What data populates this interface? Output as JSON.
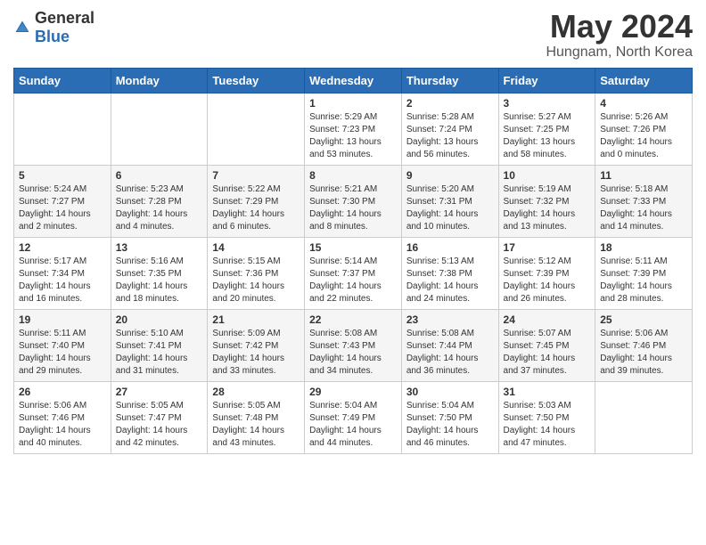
{
  "logo": {
    "general": "General",
    "blue": "Blue"
  },
  "header": {
    "title": "May 2024",
    "subtitle": "Hungnam, North Korea"
  },
  "weekdays": [
    "Sunday",
    "Monday",
    "Tuesday",
    "Wednesday",
    "Thursday",
    "Friday",
    "Saturday"
  ],
  "weeks": [
    [
      {
        "day": "",
        "info": ""
      },
      {
        "day": "",
        "info": ""
      },
      {
        "day": "",
        "info": ""
      },
      {
        "day": "1",
        "info": "Sunrise: 5:29 AM\nSunset: 7:23 PM\nDaylight: 13 hours and 53 minutes."
      },
      {
        "day": "2",
        "info": "Sunrise: 5:28 AM\nSunset: 7:24 PM\nDaylight: 13 hours and 56 minutes."
      },
      {
        "day": "3",
        "info": "Sunrise: 5:27 AM\nSunset: 7:25 PM\nDaylight: 13 hours and 58 minutes."
      },
      {
        "day": "4",
        "info": "Sunrise: 5:26 AM\nSunset: 7:26 PM\nDaylight: 14 hours and 0 minutes."
      }
    ],
    [
      {
        "day": "5",
        "info": "Sunrise: 5:24 AM\nSunset: 7:27 PM\nDaylight: 14 hours and 2 minutes."
      },
      {
        "day": "6",
        "info": "Sunrise: 5:23 AM\nSunset: 7:28 PM\nDaylight: 14 hours and 4 minutes."
      },
      {
        "day": "7",
        "info": "Sunrise: 5:22 AM\nSunset: 7:29 PM\nDaylight: 14 hours and 6 minutes."
      },
      {
        "day": "8",
        "info": "Sunrise: 5:21 AM\nSunset: 7:30 PM\nDaylight: 14 hours and 8 minutes."
      },
      {
        "day": "9",
        "info": "Sunrise: 5:20 AM\nSunset: 7:31 PM\nDaylight: 14 hours and 10 minutes."
      },
      {
        "day": "10",
        "info": "Sunrise: 5:19 AM\nSunset: 7:32 PM\nDaylight: 14 hours and 13 minutes."
      },
      {
        "day": "11",
        "info": "Sunrise: 5:18 AM\nSunset: 7:33 PM\nDaylight: 14 hours and 14 minutes."
      }
    ],
    [
      {
        "day": "12",
        "info": "Sunrise: 5:17 AM\nSunset: 7:34 PM\nDaylight: 14 hours and 16 minutes."
      },
      {
        "day": "13",
        "info": "Sunrise: 5:16 AM\nSunset: 7:35 PM\nDaylight: 14 hours and 18 minutes."
      },
      {
        "day": "14",
        "info": "Sunrise: 5:15 AM\nSunset: 7:36 PM\nDaylight: 14 hours and 20 minutes."
      },
      {
        "day": "15",
        "info": "Sunrise: 5:14 AM\nSunset: 7:37 PM\nDaylight: 14 hours and 22 minutes."
      },
      {
        "day": "16",
        "info": "Sunrise: 5:13 AM\nSunset: 7:38 PM\nDaylight: 14 hours and 24 minutes."
      },
      {
        "day": "17",
        "info": "Sunrise: 5:12 AM\nSunset: 7:39 PM\nDaylight: 14 hours and 26 minutes."
      },
      {
        "day": "18",
        "info": "Sunrise: 5:11 AM\nSunset: 7:39 PM\nDaylight: 14 hours and 28 minutes."
      }
    ],
    [
      {
        "day": "19",
        "info": "Sunrise: 5:11 AM\nSunset: 7:40 PM\nDaylight: 14 hours and 29 minutes."
      },
      {
        "day": "20",
        "info": "Sunrise: 5:10 AM\nSunset: 7:41 PM\nDaylight: 14 hours and 31 minutes."
      },
      {
        "day": "21",
        "info": "Sunrise: 5:09 AM\nSunset: 7:42 PM\nDaylight: 14 hours and 33 minutes."
      },
      {
        "day": "22",
        "info": "Sunrise: 5:08 AM\nSunset: 7:43 PM\nDaylight: 14 hours and 34 minutes."
      },
      {
        "day": "23",
        "info": "Sunrise: 5:08 AM\nSunset: 7:44 PM\nDaylight: 14 hours and 36 minutes."
      },
      {
        "day": "24",
        "info": "Sunrise: 5:07 AM\nSunset: 7:45 PM\nDaylight: 14 hours and 37 minutes."
      },
      {
        "day": "25",
        "info": "Sunrise: 5:06 AM\nSunset: 7:46 PM\nDaylight: 14 hours and 39 minutes."
      }
    ],
    [
      {
        "day": "26",
        "info": "Sunrise: 5:06 AM\nSunset: 7:46 PM\nDaylight: 14 hours and 40 minutes."
      },
      {
        "day": "27",
        "info": "Sunrise: 5:05 AM\nSunset: 7:47 PM\nDaylight: 14 hours and 42 minutes."
      },
      {
        "day": "28",
        "info": "Sunrise: 5:05 AM\nSunset: 7:48 PM\nDaylight: 14 hours and 43 minutes."
      },
      {
        "day": "29",
        "info": "Sunrise: 5:04 AM\nSunset: 7:49 PM\nDaylight: 14 hours and 44 minutes."
      },
      {
        "day": "30",
        "info": "Sunrise: 5:04 AM\nSunset: 7:50 PM\nDaylight: 14 hours and 46 minutes."
      },
      {
        "day": "31",
        "info": "Sunrise: 5:03 AM\nSunset: 7:50 PM\nDaylight: 14 hours and 47 minutes."
      },
      {
        "day": "",
        "info": ""
      }
    ]
  ]
}
